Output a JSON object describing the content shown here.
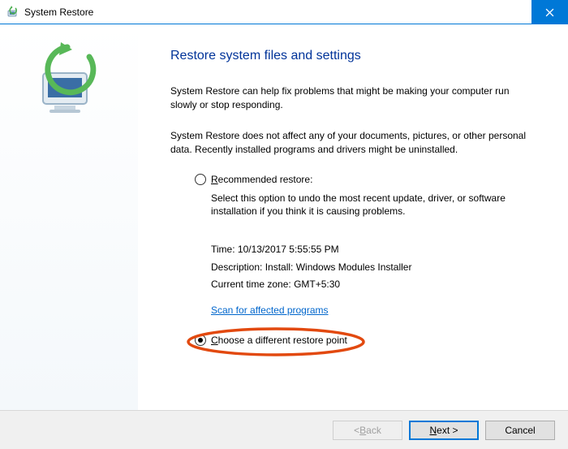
{
  "window": {
    "title": "System Restore"
  },
  "main": {
    "heading": "Restore system files and settings",
    "para1": "System Restore can help fix problems that might be making your computer run slowly or stop responding.",
    "para2": "System Restore does not affect any of your documents, pictures, or other personal data. Recently installed programs and drivers might be uninstalled.",
    "recommended": {
      "label_prefix": "R",
      "label_rest": "ecommended restore:",
      "desc": "Select this option to undo the most recent update, driver, or software installation if you think it is causing problems."
    },
    "details": {
      "time_label": "Time:",
      "time_value": "10/13/2017 5:55:55 PM",
      "desc_label": "Description:",
      "desc_value": "Install: Windows Modules Installer",
      "tz_label": "Current time zone:",
      "tz_value": "GMT+5:30",
      "scan_link": "Scan for affected programs"
    },
    "choose": {
      "label_prefix": "C",
      "label_rest": "hoose a different restore point"
    }
  },
  "footer": {
    "back_prefix": "< ",
    "back_ul": "B",
    "back_rest": "ack",
    "next_ul": "N",
    "next_rest": "ext >",
    "cancel": "Cancel"
  }
}
